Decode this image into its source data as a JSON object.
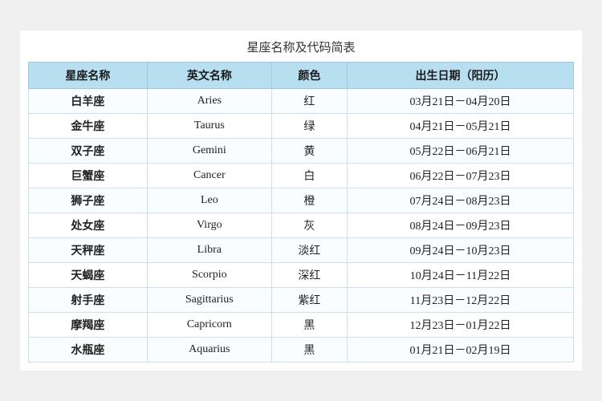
{
  "title": "星座名称及代码简表",
  "table": {
    "headers": [
      "星座名称",
      "英文名称",
      "颜色",
      "出生日期（阳历）"
    ],
    "rows": [
      {
        "cn": "白羊座",
        "en": "Aries",
        "color": "红",
        "date": "03月21日－04月20日"
      },
      {
        "cn": "金牛座",
        "en": "Taurus",
        "color": "绿",
        "date": "04月21日－05月21日"
      },
      {
        "cn": "双子座",
        "en": "Gemini",
        "color": "黄",
        "date": "05月22日－06月21日"
      },
      {
        "cn": "巨蟹座",
        "en": "Cancer",
        "color": "白",
        "date": "06月22日－07月23日"
      },
      {
        "cn": "狮子座",
        "en": "Leo",
        "color": "橙",
        "date": "07月24日－08月23日"
      },
      {
        "cn": "处女座",
        "en": "Virgo",
        "color": "灰",
        "date": "08月24日－09月23日"
      },
      {
        "cn": "天秤座",
        "en": "Libra",
        "color": "淡红",
        "date": "09月24日－10月23日"
      },
      {
        "cn": "天蝎座",
        "en": "Scorpio",
        "color": "深红",
        "date": "10月24日－11月22日"
      },
      {
        "cn": "射手座",
        "en": "Sagittarius",
        "color": "紫红",
        "date": "11月23日－12月22日"
      },
      {
        "cn": "摩羯座",
        "en": "Capricorn",
        "color": "黑",
        "date": "12月23日－01月22日"
      },
      {
        "cn": "水瓶座",
        "en": "Aquarius",
        "color": "黑",
        "date": "01月21日－02月19日"
      }
    ]
  }
}
